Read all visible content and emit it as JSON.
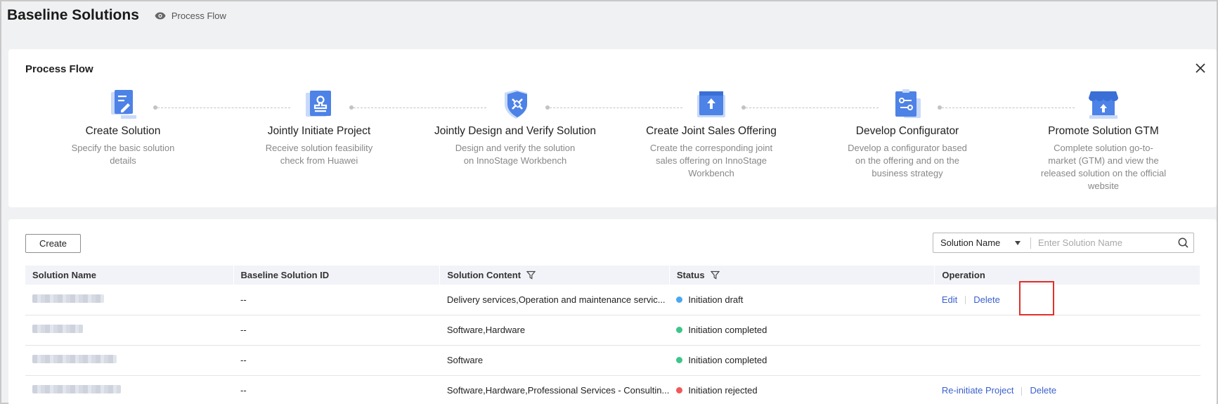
{
  "header": {
    "title": "Baseline Solutions",
    "process_flow_link": "Process Flow"
  },
  "process_flow": {
    "title": "Process Flow",
    "steps": [
      {
        "title": "Create Solution",
        "desc": "Specify the basic solution details",
        "icon": "document-edit-icon"
      },
      {
        "title": "Jointly Initiate Project",
        "desc": "Receive solution feasibility check from Huawei",
        "icon": "stamp-icon"
      },
      {
        "title": "Jointly Design and Verify Solution",
        "desc": "Design and verify the solution on InnoStage Workbench",
        "icon": "shield-tools-icon"
      },
      {
        "title": "Create Joint Sales Offering",
        "desc": "Create the corresponding joint sales offering on InnoStage Workbench",
        "icon": "upload-box-icon"
      },
      {
        "title": "Develop Configurator",
        "desc": "Develop a configurator based on the offering and on the business strategy",
        "icon": "configurator-icon"
      },
      {
        "title": "Promote Solution GTM",
        "desc": "Complete solution go-to-market (GTM) and view the released solution on the official website",
        "icon": "store-icon"
      }
    ]
  },
  "toolbar": {
    "create_label": "Create",
    "search_field_selected": "Solution Name",
    "search_placeholder": "Enter Solution Name"
  },
  "table": {
    "columns": [
      "Solution Name",
      "Baseline Solution ID",
      "Solution Content",
      "Status",
      "Operation"
    ],
    "rows": [
      {
        "id": "--",
        "content": "Delivery services,Operation and maintenance servic...",
        "status": "Initiation draft",
        "status_color": "#4aa8f0",
        "ops": [
          "Edit",
          "Delete"
        ]
      },
      {
        "id": "--",
        "content": "Software,Hardware",
        "status": "Initiation completed",
        "status_color": "#3cc68a",
        "ops": []
      },
      {
        "id": "--",
        "content": "Software",
        "status": "Initiation completed",
        "status_color": "#3cc68a",
        "ops": []
      },
      {
        "id": "--",
        "content": "Software,Hardware,Professional Services - Consultin...",
        "status": "Initiation rejected",
        "status_color": "#f0585a",
        "ops": [
          "Re-initiate Project",
          "Delete"
        ]
      }
    ]
  },
  "colors": {
    "accent": "#3a5fcd",
    "icon_blue": "#4d82e6",
    "icon_light": "#c9daf8",
    "highlight": "#e0302a"
  }
}
